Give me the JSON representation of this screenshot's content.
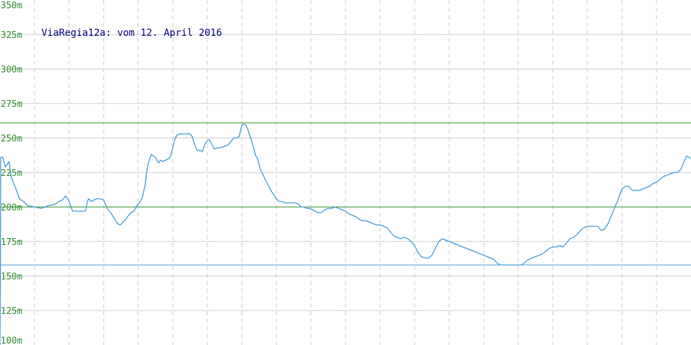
{
  "chart_data": {
    "type": "line",
    "title": "ViaRegia12a: vom 12. April 2016",
    "ylim": [
      100,
      350
    ],
    "y_ticks": [
      "350m",
      "325m",
      "300m",
      "275m",
      "250m",
      "225m",
      "200m",
      "175m",
      "150m",
      "125m",
      "100m"
    ],
    "y_tick_values": [
      350,
      325,
      300,
      275,
      250,
      225,
      200,
      175,
      150,
      125,
      100
    ],
    "grid": true,
    "reference_lines": [
      {
        "value": 261,
        "color": "#228b22"
      },
      {
        "value": 200,
        "color": "#228b22"
      },
      {
        "value": 158,
        "color": "#3a99d8"
      }
    ],
    "series": [
      {
        "color": "#3a99d8",
        "points": [
          [
            0,
            0.07
          ],
          [
            0.5,
            140
          ],
          [
            1,
            236
          ],
          [
            4,
            236
          ],
          [
            8,
            229
          ],
          [
            13,
            233
          ],
          [
            16,
            222
          ],
          [
            20,
            217
          ],
          [
            24,
            212
          ],
          [
            28,
            206
          ],
          [
            34,
            204
          ],
          [
            40,
            201
          ],
          [
            50,
            200
          ],
          [
            60,
            199
          ],
          [
            70,
            201
          ],
          [
            80,
            202
          ],
          [
            85,
            204
          ],
          [
            90,
            205
          ],
          [
            95,
            208
          ],
          [
            100,
            204
          ],
          [
            105,
            197
          ],
          [
            110,
            197
          ],
          [
            118,
            197
          ],
          [
            124,
            197
          ],
          [
            126,
            203
          ],
          [
            128,
            206
          ],
          [
            132,
            204
          ],
          [
            136,
            205
          ],
          [
            140,
            206
          ],
          [
            145,
            206
          ],
          [
            150,
            205
          ],
          [
            155,
            199
          ],
          [
            160,
            196
          ],
          [
            165,
            192
          ],
          [
            170,
            188
          ],
          [
            174,
            187
          ],
          [
            178,
            189
          ],
          [
            182,
            191
          ],
          [
            186,
            194
          ],
          [
            190,
            196
          ],
          [
            194,
            197
          ],
          [
            198,
            201
          ],
          [
            202,
            203
          ],
          [
            206,
            207
          ],
          [
            210,
            216
          ],
          [
            213,
            228
          ],
          [
            216,
            234
          ],
          [
            219,
            238
          ],
          [
            222,
            237
          ],
          [
            225,
            236
          ],
          [
            228,
            233
          ],
          [
            230,
            232
          ],
          [
            232,
            234
          ],
          [
            236,
            233
          ],
          [
            240,
            234
          ],
          [
            244,
            235
          ],
          [
            247,
            237
          ],
          [
            250,
            243
          ],
          [
            253,
            249
          ],
          [
            256,
            252
          ],
          [
            260,
            253
          ],
          [
            265,
            253
          ],
          [
            270,
            253
          ],
          [
            275,
            253
          ],
          [
            278,
            251
          ],
          [
            282,
            245
          ],
          [
            285,
            241
          ],
          [
            288,
            241
          ],
          [
            290,
            241
          ],
          [
            293,
            240
          ],
          [
            296,
            245
          ],
          [
            300,
            248
          ],
          [
            303,
            249
          ],
          [
            307,
            245
          ],
          [
            309,
            243
          ],
          [
            310,
            242
          ],
          [
            315,
            243
          ],
          [
            320,
            243
          ],
          [
            325,
            244
          ],
          [
            330,
            245
          ],
          [
            335,
            248
          ],
          [
            338,
            250
          ],
          [
            342,
            250
          ],
          [
            346,
            251
          ],
          [
            350,
            259
          ],
          [
            352,
            260
          ],
          [
            354,
            260
          ],
          [
            356,
            259
          ],
          [
            358,
            257
          ],
          [
            360,
            254
          ],
          [
            362,
            251
          ],
          [
            364,
            248
          ],
          [
            366,
            245
          ],
          [
            368,
            241
          ],
          [
            370,
            237
          ],
          [
            372,
            236
          ],
          [
            374,
            233
          ],
          [
            376,
            228
          ],
          [
            379,
            225
          ],
          [
            382,
            222
          ],
          [
            385,
            219
          ],
          [
            388,
            216
          ],
          [
            392,
            212
          ],
          [
            396,
            209
          ],
          [
            400,
            206
          ],
          [
            404,
            204
          ],
          [
            408,
            204
          ],
          [
            412,
            203
          ],
          [
            416,
            203
          ],
          [
            420,
            203
          ],
          [
            424,
            203
          ],
          [
            428,
            203
          ],
          [
            432,
            202
          ],
          [
            436,
            200
          ],
          [
            440,
            200
          ],
          [
            444,
            199
          ],
          [
            448,
            199
          ],
          [
            452,
            198
          ],
          [
            456,
            197
          ],
          [
            460,
            196
          ],
          [
            465,
            196
          ],
          [
            470,
            198
          ],
          [
            475,
            199
          ],
          [
            480,
            199
          ],
          [
            485,
            200
          ],
          [
            490,
            199
          ],
          [
            495,
            198
          ],
          [
            500,
            197
          ],
          [
            505,
            195
          ],
          [
            510,
            194
          ],
          [
            515,
            193
          ],
          [
            520,
            191
          ],
          [
            525,
            190
          ],
          [
            530,
            190
          ],
          [
            535,
            189
          ],
          [
            540,
            188
          ],
          [
            545,
            187
          ],
          [
            550,
            187
          ],
          [
            555,
            186
          ],
          [
            560,
            185
          ],
          [
            565,
            182
          ],
          [
            570,
            179
          ],
          [
            575,
            178
          ],
          [
            580,
            177
          ],
          [
            585,
            178
          ],
          [
            590,
            177
          ],
          [
            595,
            175
          ],
          [
            600,
            172
          ],
          [
            605,
            167
          ],
          [
            610,
            164
          ],
          [
            615,
            163
          ],
          [
            620,
            163
          ],
          [
            625,
            165
          ],
          [
            630,
            170
          ],
          [
            635,
            175
          ],
          [
            640,
            177
          ],
          [
            645,
            176
          ],
          [
            650,
            175
          ],
          [
            655,
            174
          ],
          [
            660,
            173
          ],
          [
            665,
            172
          ],
          [
            670,
            171
          ],
          [
            675,
            170
          ],
          [
            680,
            169
          ],
          [
            685,
            168
          ],
          [
            690,
            167
          ],
          [
            695,
            166
          ],
          [
            700,
            165
          ],
          [
            705,
            164
          ],
          [
            710,
            163
          ],
          [
            715,
            162
          ],
          [
            720,
            159
          ],
          [
            725,
            158
          ],
          [
            730,
            158
          ],
          [
            735,
            158
          ],
          [
            740,
            158
          ],
          [
            745,
            158
          ],
          [
            750,
            158
          ],
          [
            755,
            158
          ],
          [
            760,
            160
          ],
          [
            765,
            162
          ],
          [
            770,
            163
          ],
          [
            775,
            164
          ],
          [
            780,
            165
          ],
          [
            785,
            166
          ],
          [
            790,
            168
          ],
          [
            795,
            170
          ],
          [
            800,
            171
          ],
          [
            805,
            171
          ],
          [
            810,
            172
          ],
          [
            815,
            171
          ],
          [
            820,
            174
          ],
          [
            825,
            177
          ],
          [
            830,
            178
          ],
          [
            835,
            180
          ],
          [
            840,
            183
          ],
          [
            845,
            185
          ],
          [
            850,
            186
          ],
          [
            855,
            186
          ],
          [
            860,
            186
          ],
          [
            865,
            186
          ],
          [
            870,
            183
          ],
          [
            875,
            184
          ],
          [
            880,
            188
          ],
          [
            885,
            194
          ],
          [
            890,
            200
          ],
          [
            895,
            206
          ],
          [
            900,
            213
          ],
          [
            905,
            215
          ],
          [
            910,
            215
          ],
          [
            915,
            212
          ],
          [
            920,
            212
          ],
          [
            925,
            212
          ],
          [
            930,
            213
          ],
          [
            935,
            214
          ],
          [
            940,
            215
          ],
          [
            945,
            217
          ],
          [
            950,
            218
          ],
          [
            955,
            220
          ],
          [
            960,
            222
          ],
          [
            965,
            223
          ],
          [
            970,
            224
          ],
          [
            975,
            225
          ],
          [
            980,
            225
          ],
          [
            985,
            227
          ],
          [
            990,
            233
          ],
          [
            994,
            237
          ],
          [
            1000,
            235
          ]
        ]
      }
    ]
  }
}
